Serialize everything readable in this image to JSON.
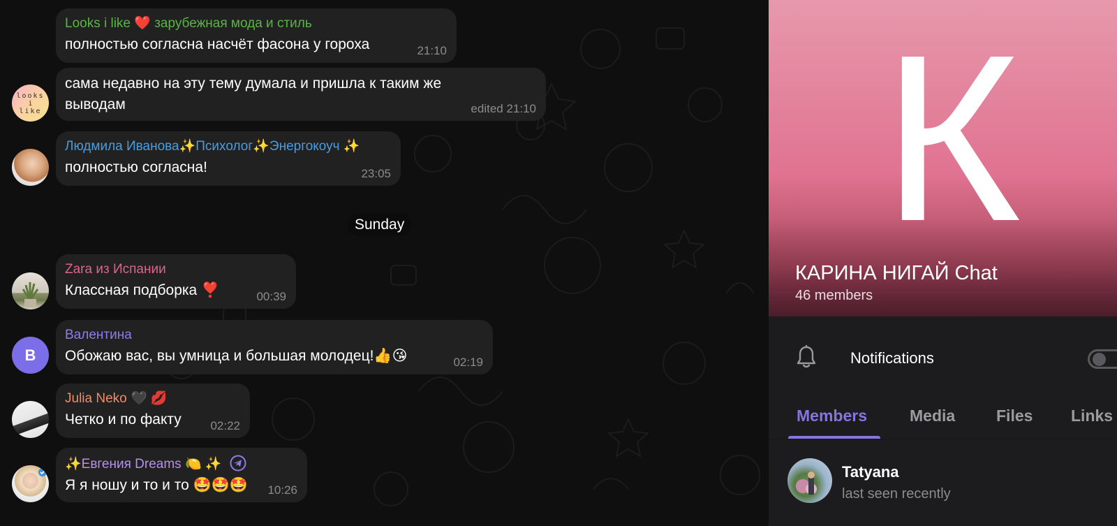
{
  "chat": {
    "messages": [
      {
        "sender": "Looks i like ❤️ зарубежная мода и стиль",
        "text": "полностью согласна насчёт фасона у гороха",
        "time": "21:10"
      },
      {
        "sender": "",
        "text": "сама недавно на эту тему думала и пришла к таким же выводам",
        "time": "edited 21:10"
      },
      {
        "sender": "Людмила Иванова✨Психолог✨Энергокоуч ✨",
        "text": "полностью согласна!",
        "time": "23:05"
      },
      {
        "sender": "Zara из Испании",
        "text": "Классная подборка ❣️",
        "time": "00:39"
      },
      {
        "sender": "Валентина",
        "text": "Обожаю вас, вы умница и большая молодец!👍😘",
        "time": "02:19"
      },
      {
        "sender": "Julia Neko 🖤 💋",
        "text": "Четко и по факту",
        "time": "02:22"
      },
      {
        "sender": "✨Евгения Dreams 🍋 ✨",
        "text": "Я я ношу и то и то 🤩🤩🤩",
        "time": "10:26"
      }
    ],
    "day_divider": "Sunday",
    "avatar_letters": {
      "looks": "looks\ni\nlike",
      "valentina": "В"
    }
  },
  "panel": {
    "hero_letter": "К",
    "title": "КАРИНА НИГАЙ Chat",
    "members_count": "46 members",
    "notifications_label": "Notifications",
    "notifications_enabled": false,
    "tabs": [
      "Members",
      "Media",
      "Files",
      "Links"
    ],
    "active_tab": "Members",
    "member_list": [
      {
        "name": "Tatyana",
        "status": "last seen recently"
      }
    ]
  },
  "colors": {
    "accent": "#8774e1",
    "sender_looks": "#59b544",
    "sender_lyudmila": "#4a9ce0",
    "sender_zara": "#e0628e",
    "sender_valentina": "#8f7dea",
    "sender_julia": "#f08c6a",
    "sender_evgenia": "#b78ff2"
  }
}
